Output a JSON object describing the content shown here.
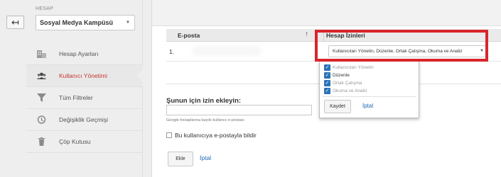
{
  "sidebar": {
    "account_label": "HESAP",
    "account_name": "Sosyal Medya Kampüsü",
    "items": [
      {
        "label": "Hesap Ayarları",
        "icon": "building-icon"
      },
      {
        "label": "Kullanıcı Yönetimi",
        "icon": "users-icon"
      },
      {
        "label": "Tüm Filtreler",
        "icon": "filter-icon"
      },
      {
        "label": "Değişiklik Geçmişi",
        "icon": "history-icon"
      },
      {
        "label": "Çöp Kutusu",
        "icon": "trash-icon"
      }
    ],
    "active_item": "Kullanıcı Yönetimi"
  },
  "table": {
    "col_email": "E-posta",
    "col_permissions": "Hesap İzinleri",
    "rows": [
      {
        "index": "1.",
        "permissions": "Kullanıcıları Yönetin, Düzenle, Ortak Çalışma, Okuma ve Analiz"
      }
    ]
  },
  "dropdown": {
    "options": [
      {
        "label": "Kullanıcıları Yönetin",
        "checked": true
      },
      {
        "label": "Düzenle",
        "checked": true
      },
      {
        "label": "Ortak Çalışma",
        "checked": true
      },
      {
        "label": "Okuma ve Analiz",
        "checked": true
      }
    ],
    "save_label": "Kaydet",
    "cancel_label": "İptal"
  },
  "add_form": {
    "title": "Şunun için izin ekleyin:",
    "hint": "Google hesaplarına kayıtlı kullanıcı e-postası",
    "notify_label": "Bu kullanıcıya e-postayla bildir",
    "add_label": "Ekle",
    "cancel_label": "İptal"
  },
  "colors": {
    "accent_red": "#d9252b",
    "active_nav": "#c5372e",
    "link_blue": "#1a65b5",
    "checkbox_blue": "#2b73b7"
  }
}
